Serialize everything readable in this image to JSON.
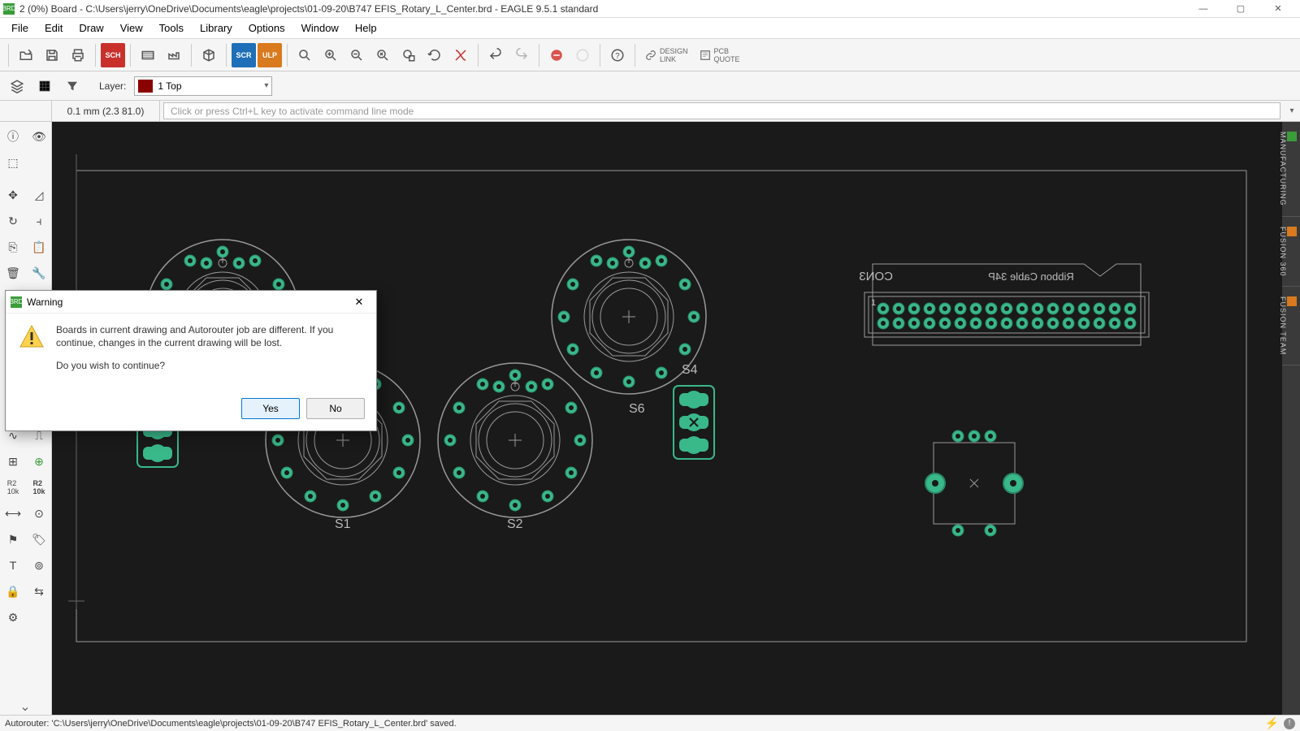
{
  "window": {
    "title": "2 (0%) Board - C:\\Users\\jerry\\OneDrive\\Documents\\eagle\\projects\\01-09-20\\B747 EFIS_Rotary_L_Center.brd - EAGLE 9.5.1 standard"
  },
  "menubar": {
    "items": [
      "File",
      "Edit",
      "Draw",
      "View",
      "Tools",
      "Library",
      "Options",
      "Window",
      "Help"
    ]
  },
  "toolbar": {
    "design_link": "DESIGN\nLINK",
    "pcb_quote": "PCB\nQUOTE"
  },
  "layerbar": {
    "label": "Layer:",
    "selected": "1 Top"
  },
  "coordbar": {
    "coord": "0.1 mm (2.3 81.0)",
    "cmd_placeholder": "Click or press Ctrl+L key to activate command line mode"
  },
  "right_tabs": [
    "MANUFACTURING",
    "FUSION 360",
    "FUSION TEAM"
  ],
  "canvas_labels": {
    "s1": "S1",
    "s2": "S2",
    "s4": "S4",
    "s6": "S6",
    "con3": "CON3",
    "ribbon": "Ribbon Cable 34P"
  },
  "modal": {
    "title": "Warning",
    "line1": "Boards in current drawing and Autorouter job are different. If you continue, changes in the current drawing will be lost.",
    "line2": "Do you wish to continue?",
    "yes": "Yes",
    "no": "No"
  },
  "status": {
    "text": "Autorouter: 'C:\\Users\\jerry\\OneDrive\\Documents\\eagle\\projects\\01-09-20\\B747 EFIS_Rotary_L_Center.brd' saved."
  }
}
